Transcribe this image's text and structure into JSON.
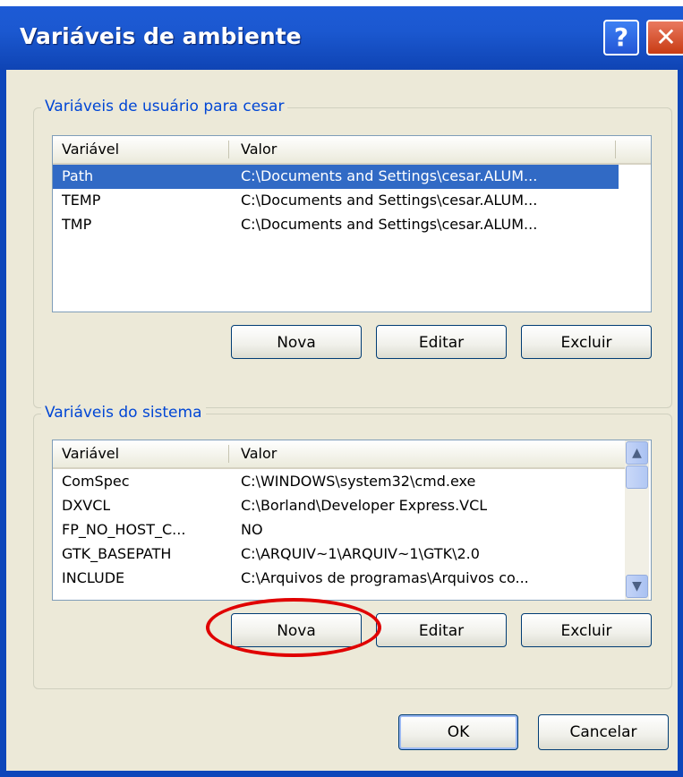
{
  "window": {
    "title": "Variáveis de ambiente",
    "help_icon": "?",
    "close_icon": "✕"
  },
  "user_vars": {
    "group_label": "Variáveis de usuário para cesar",
    "columns": [
      "Variável",
      "Valor"
    ],
    "rows": [
      {
        "name": "Path",
        "value": "C:\\Documents and Settings\\cesar.ALUM...",
        "selected": true
      },
      {
        "name": "TEMP",
        "value": "C:\\Documents and Settings\\cesar.ALUM...",
        "selected": false
      },
      {
        "name": "TMP",
        "value": "C:\\Documents and Settings\\cesar.ALUM...",
        "selected": false
      }
    ],
    "buttons": {
      "new": "Nova",
      "edit": "Editar",
      "delete": "Excluir"
    }
  },
  "system_vars": {
    "group_label": "Variáveis do sistema",
    "columns": [
      "Variável",
      "Valor"
    ],
    "rows": [
      {
        "name": "ComSpec",
        "value": "C:\\WINDOWS\\system32\\cmd.exe"
      },
      {
        "name": "DXVCL",
        "value": "C:\\Borland\\Developer Express.VCL"
      },
      {
        "name": "FP_NO_HOST_C...",
        "value": "NO"
      },
      {
        "name": "GTK_BASEPATH",
        "value": "C:\\ARQUIV~1\\ARQUIV~1\\GTK\\2.0"
      },
      {
        "name": "INCLUDE",
        "value": "C:\\Arquivos de programas\\Arquivos co..."
      }
    ],
    "buttons": {
      "new": "Nova",
      "edit": "Editar",
      "delete": "Excluir"
    }
  },
  "footer": {
    "ok": "OK",
    "cancel": "Cancelar"
  },
  "colors": {
    "selection": "#316ac5",
    "group_label": "#0046d5",
    "annotation": "#e00000",
    "titlebar": "#1b58d0"
  },
  "icons": {
    "scroll_up": "scroll-up-arrow-icon",
    "scroll_down": "scroll-down-arrow-icon"
  }
}
